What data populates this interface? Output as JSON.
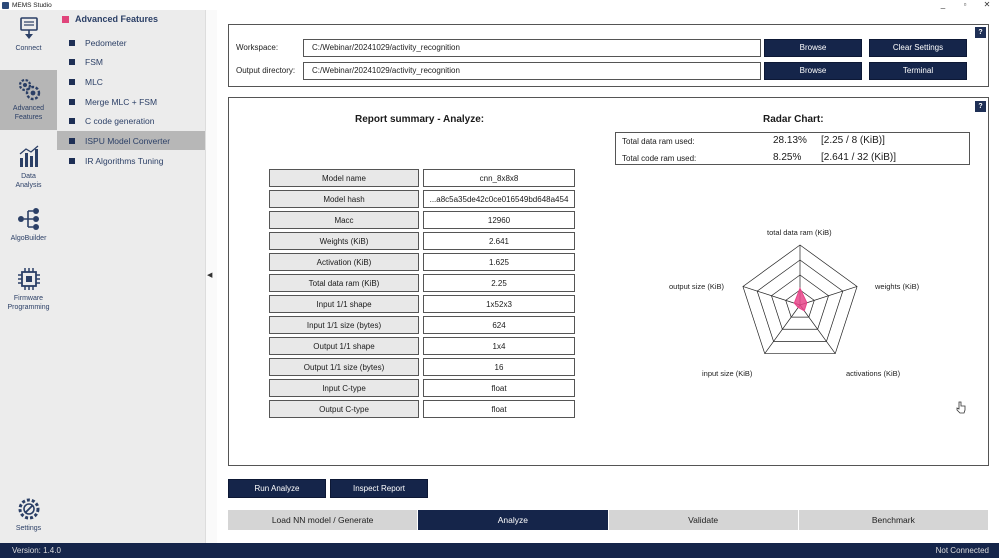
{
  "window": {
    "title": "MEMS Studio",
    "minimize": "_",
    "restore": "▫",
    "close": "✕"
  },
  "sidebar": {
    "items": [
      {
        "label": "Connect",
        "icon": "connect-icon"
      },
      {
        "label": "Advanced Features",
        "icon": "gears-icon"
      },
      {
        "label": "Data Analysis",
        "icon": "bar-chart-icon"
      },
      {
        "label": "AlgoBuilder",
        "icon": "flow-icon"
      },
      {
        "label": "Firmware Programming",
        "icon": "chip-icon"
      }
    ],
    "settings_label": "Settings"
  },
  "submenu": {
    "title": "Advanced Features",
    "items": [
      {
        "label": "Pedometer"
      },
      {
        "label": "FSM"
      },
      {
        "label": "MLC"
      },
      {
        "label": "Merge MLC + FSM"
      },
      {
        "label": "C code generation"
      },
      {
        "label": "ISPU Model Converter"
      },
      {
        "label": "IR Algorithms Tuning"
      }
    ]
  },
  "config": {
    "help": "?",
    "workspace_label": "Workspace:",
    "workspace_value": "C:/Webinar/20241029/activity_recognition",
    "output_label": "Output directory:",
    "output_value": "C:/Webinar/20241029/activity_recognition",
    "browse_label": "Browse",
    "clear_settings_label": "Clear Settings",
    "terminal_label": "Terminal"
  },
  "report": {
    "help": "?",
    "title": "Report summary - Analyze:",
    "rows": [
      {
        "key": "Model name",
        "value": "cnn_8x8x8"
      },
      {
        "key": "Model hash",
        "value": "...a8c5a35de42c0ce016549bd648a454"
      },
      {
        "key": "Macc",
        "value": "12960"
      },
      {
        "key": "Weights (KiB)",
        "value": "2.641"
      },
      {
        "key": "Activation (KiB)",
        "value": "1.625"
      },
      {
        "key": "Total data ram (KiB)",
        "value": "2.25"
      },
      {
        "key": "Input 1/1 shape",
        "value": "1x52x3"
      },
      {
        "key": "Input 1/1 size (bytes)",
        "value": "624"
      },
      {
        "key": "Output 1/1 shape",
        "value": "1x4"
      },
      {
        "key": "Output 1/1 size (bytes)",
        "value": "16"
      },
      {
        "key": "Input C-type",
        "value": "float"
      },
      {
        "key": "Output C-type",
        "value": "float"
      }
    ]
  },
  "radar": {
    "title": "Radar Chart:",
    "data_ram_label": "Total data ram used:",
    "data_ram_percent": "28.13%",
    "data_ram_detail": "[2.25 / 8 (KiB)]",
    "code_ram_label": "Total code ram used:",
    "code_ram_percent": "8.25%",
    "code_ram_detail": "[2.641 / 32 (KiB)]",
    "axis_labels": {
      "top": "total data ram (KiB)",
      "right": "weights (KiB)",
      "bottom_right": "activations (KiB)",
      "bottom_left": "input size (KiB)",
      "left": "output size (KiB)"
    },
    "series_color": "#e8458a"
  },
  "actions": {
    "run_analyze": "Run Analyze",
    "inspect_report": "Inspect Report"
  },
  "tabs": [
    {
      "label": "Load NN model / Generate"
    },
    {
      "label": "Analyze"
    },
    {
      "label": "Validate"
    },
    {
      "label": "Benchmark"
    }
  ],
  "status": {
    "version": "Version: 1.4.0",
    "connection": "Not Connected"
  }
}
